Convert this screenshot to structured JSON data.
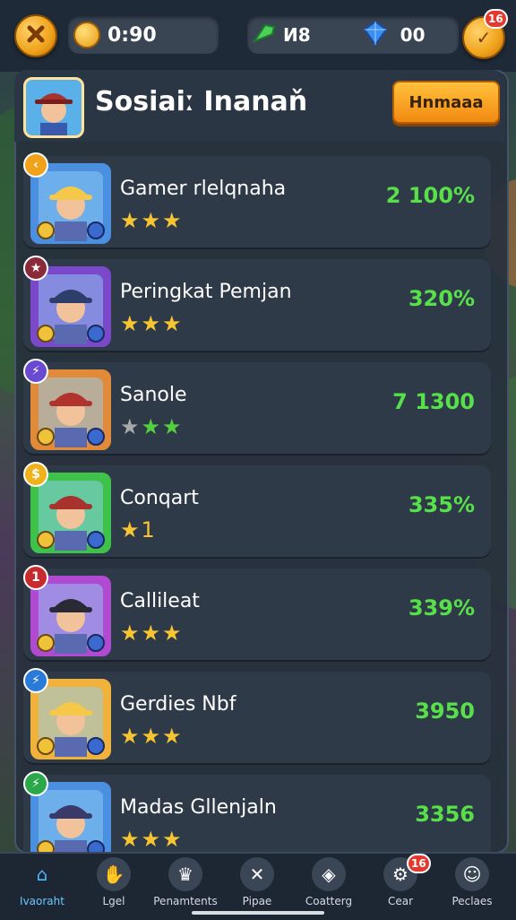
{
  "top": {
    "coins": "0:90",
    "gems_label": "И8",
    "diamonds": "00",
    "notif_badge": "16"
  },
  "panel": {
    "title": "Sosiaiː Inanaň",
    "action_label": "Hnmaaa"
  },
  "rows": [
    {
      "name": "Gamer rlelqnaha",
      "score": "2 100%",
      "stars": "★★★",
      "star_colors": [
        "#f7c531",
        "#f7c531",
        "#f7c531"
      ],
      "corner_color": "#f0a21a",
      "corner_glyph": "‹",
      "avatar_bg": "#4a8fe0",
      "hat_color": "#f5c84a"
    },
    {
      "name": "Peringkat Pemjan",
      "score": "320%",
      "stars": "★★★",
      "star_colors": [
        "#f7c531",
        "#f7c531",
        "#f7c531"
      ],
      "corner_color": "#8a2a3a",
      "corner_glyph": "★",
      "avatar_bg": "#7a48c8",
      "hat_color": "#2e3e6a"
    },
    {
      "name": "Sanole",
      "score": "7 1300",
      "stars": "★★★",
      "star_colors": [
        "#a8a8a8",
        "#52d13e",
        "#52d13e"
      ],
      "corner_color": "#6a4ad0",
      "corner_glyph": "⚡",
      "avatar_bg": "#e08a3a",
      "hat_color": "#b0332e"
    },
    {
      "name": "Conqart",
      "score": "335%",
      "stars": "★1",
      "star_colors": [
        "#f7c531",
        "#f7c531"
      ],
      "corner_color": "#f0b21a",
      "corner_glyph": "$",
      "avatar_bg": "#3fc24a",
      "hat_color": "#a8322e"
    },
    {
      "name": "Callileat",
      "score": "339%",
      "stars": "★★★",
      "star_colors": [
        "#f7c531",
        "#f7c531",
        "#f7c531"
      ],
      "corner_color": "#c82a2e",
      "corner_glyph": "1",
      "avatar_bg": "#b04ad0",
      "hat_color": "#2a2a36"
    },
    {
      "name": "Gerdies Nbf",
      "score": "3950",
      "stars": "★★★",
      "star_colors": [
        "#f7c531",
        "#f7c531",
        "#f7c531"
      ],
      "corner_color": "#2a7ad8",
      "corner_glyph": "⚡",
      "avatar_bg": "#f0b23a",
      "hat_color": "#f5c84a"
    },
    {
      "name": "Madas Gllenjaln",
      "score": "3356",
      "stars": "★★★",
      "star_colors": [
        "#f7c531",
        "#f7c531",
        "#f7c531"
      ],
      "corner_color": "#2aa84a",
      "corner_glyph": "⚡",
      "avatar_bg": "#4a8fe0",
      "hat_color": "#3a3a6a"
    }
  ],
  "nav": [
    {
      "label": "Ivaoraht",
      "icon": "home-icon",
      "glyph": "⌂",
      "active": true
    },
    {
      "label": "Lgel",
      "icon": "bag-icon",
      "glyph": "✋",
      "badge": ""
    },
    {
      "label": "Penamtents",
      "icon": "trophy-icon",
      "glyph": "♛"
    },
    {
      "label": "Pipae",
      "icon": "swords-icon",
      "glyph": "✕"
    },
    {
      "label": "Coatterg",
      "icon": "shield-icon",
      "glyph": "◈"
    },
    {
      "label": "Cear",
      "icon": "gear-icon",
      "glyph": "⚙",
      "badge": "16"
    },
    {
      "label": "Peclaes",
      "icon": "friends-icon",
      "glyph": "☺"
    }
  ]
}
